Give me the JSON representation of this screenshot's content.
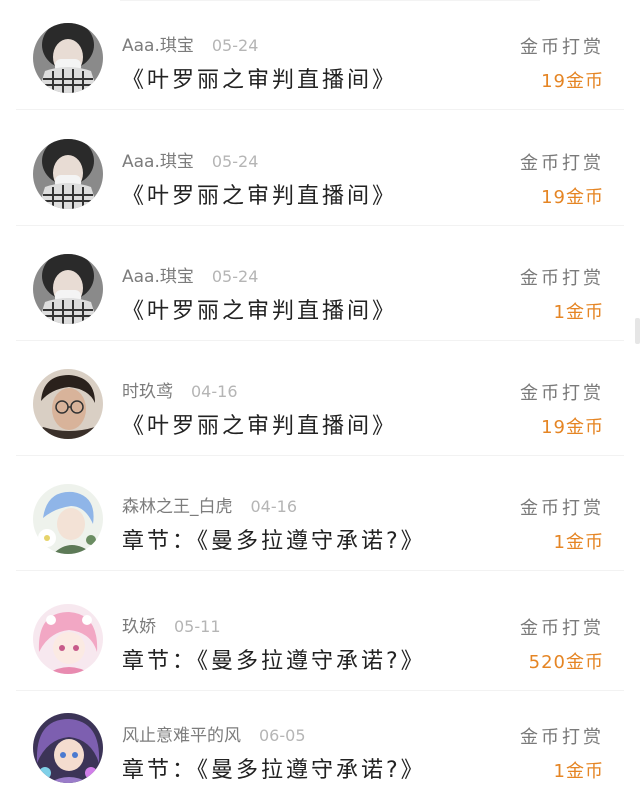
{
  "items": [
    {
      "name": "Aaa.琪宝",
      "date": "05-24",
      "content": "《叶罗丽之审判直播间》",
      "action": "金币打赏",
      "amount": "19金币",
      "avatar": "masked-girl-avatar"
    },
    {
      "name": "Aaa.琪宝",
      "date": "05-24",
      "content": "《叶罗丽之审判直播间》",
      "action": "金币打赏",
      "amount": "19金币",
      "avatar": "masked-girl-avatar"
    },
    {
      "name": "Aaa.琪宝",
      "date": "05-24",
      "content": "《叶罗丽之审判直播间》",
      "action": "金币打赏",
      "amount": "1金币",
      "avatar": "masked-girl-avatar"
    },
    {
      "name": "时玖鸢",
      "date": "04-16",
      "content": "《叶罗丽之审判直播间》",
      "action": "金币打赏",
      "amount": "19金币",
      "avatar": "glasses-boy-avatar"
    },
    {
      "name": "森林之王_白虎",
      "date": "04-16",
      "content": "章节：《曼多拉遵守承诺?》",
      "action": "金币打赏",
      "amount": "1金币",
      "avatar": "anime-blue-hair-avatar"
    },
    {
      "name": "玖娇",
      "date": "05-11",
      "content": "章节：《曼多拉遵守承诺?》",
      "action": "金币打赏",
      "amount": "520金币",
      "avatar": "anime-pink-hair-avatar"
    },
    {
      "name": "风止意难平的风",
      "date": "06-05",
      "content": "章节：《曼多拉遵守承诺?》",
      "action": "金币打赏",
      "amount": "1金币",
      "avatar": "anime-purple-hair-avatar"
    }
  ],
  "colors": {
    "accent": "#e58524",
    "name": "#7c7c7c",
    "date": "#b5b5b5",
    "text": "#222222"
  }
}
